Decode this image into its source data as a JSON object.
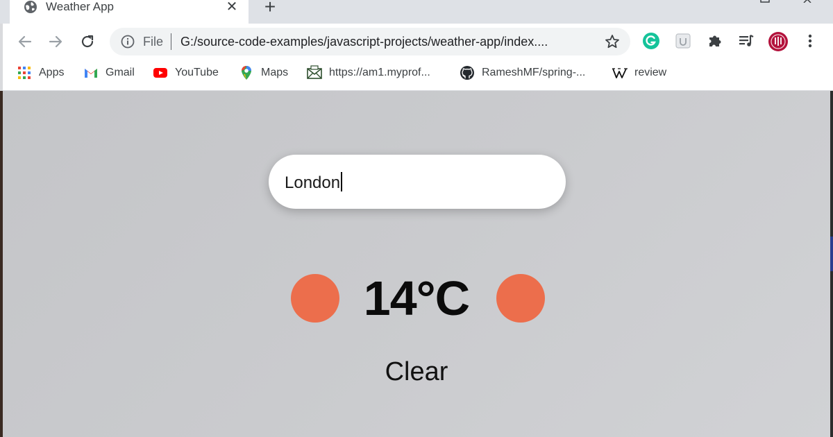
{
  "browser": {
    "tab": {
      "title": "Weather App",
      "close_symbol": "✕",
      "icon": "globe-icon"
    },
    "new_tab_symbol": "+",
    "omnibox": {
      "security_label": "File",
      "url": "G:/source-code-examples/javascript-projects/weather-app/index...."
    },
    "bookmarks": [
      {
        "label": "Apps",
        "icon": "apps-grid-icon"
      },
      {
        "label": "Gmail",
        "icon": "gmail-icon"
      },
      {
        "label": "YouTube",
        "icon": "youtube-icon"
      },
      {
        "label": "Maps",
        "icon": "maps-pin-icon"
      },
      {
        "label": "https://am1.myprof...",
        "icon": "envelope-icon"
      },
      {
        "label": "RameshMF/spring-...",
        "icon": "github-icon"
      },
      {
        "label": "review",
        "icon": "wikipedia-icon"
      }
    ],
    "extensions": [
      "grammarly-icon",
      "extension-box-icon",
      "puzzle-icon",
      "media-queue-icon",
      "profile-avatar-icon",
      "menu-kebab-icon"
    ]
  },
  "weather": {
    "city_input": "London",
    "temperature": "14°C",
    "condition": "Clear"
  },
  "colors": {
    "sun": "#ec6e4c",
    "page_background": "#c8c9cc",
    "grammarly": "#15c39a",
    "avatar": "#b3123c"
  }
}
